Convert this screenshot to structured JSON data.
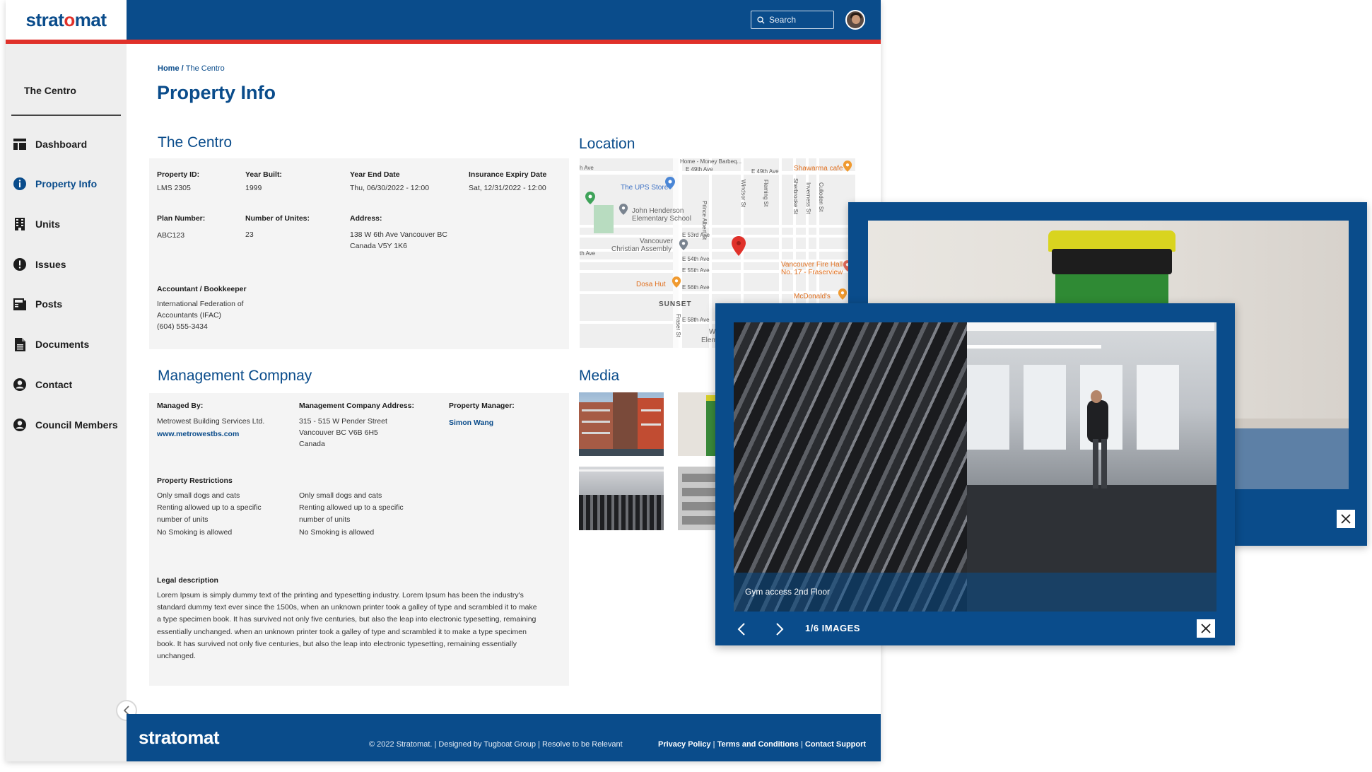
{
  "brand": {
    "name_pre": "strat",
    "name_o": "o",
    "name_post": "mat",
    "footer_name": "stratomat",
    "primary": "#0a4c8b",
    "accent": "#e0312a"
  },
  "header": {
    "search_placeholder": "Search"
  },
  "sidebar": {
    "title": "The Centro",
    "items": [
      {
        "label": "Dashboard",
        "icon": "dashboard-icon"
      },
      {
        "label": "Property Info",
        "icon": "info-icon",
        "active": true
      },
      {
        "label": "Units",
        "icon": "building-icon"
      },
      {
        "label": "Issues",
        "icon": "alert-icon"
      },
      {
        "label": "Posts",
        "icon": "posts-icon"
      },
      {
        "label": "Documents",
        "icon": "document-icon"
      },
      {
        "label": "Contact",
        "icon": "user-icon"
      },
      {
        "label": "Council Members",
        "icon": "user-icon"
      }
    ]
  },
  "breadcrumb": {
    "home": "Home",
    "sep": " / ",
    "current": "The Centro"
  },
  "page_title": "Property Info",
  "property": {
    "section_title": "The Centro",
    "property_id_label": "Property ID:",
    "property_id": "LMS 2305",
    "year_built_label": "Year Built:",
    "year_built": "1999",
    "year_end_label": "Year End Date",
    "year_end": "Thu, 06/30/2022 - 12:00",
    "insurance_label": "Insurance Expiry Date",
    "insurance": "Sat, 12/31/2022 - 12:00",
    "plan_label": "Plan Number:",
    "plan": "ABC123",
    "units_label": "Number of Unites:",
    "units": "23",
    "address_label": "Address:",
    "address": "138 W 6th Ave Vancouver BC\nCanada  V5Y 1K6",
    "accountant_label": "Accountant / Bookkeeper",
    "accountant": "International Federation of\nAccountants (IFAC)\n(604) 555-3434"
  },
  "management": {
    "section_title": "Management Compnay",
    "managed_by_label": "Managed By:",
    "managed_by": "Metrowest Building Services Ltd.",
    "website": "www.metrowestbs.com",
    "address_label": "Management Company Address:",
    "address": "315 - 515 W Pender Street\nVancouver BC V6B 6H5\nCanada",
    "manager_label": "Property Manager:",
    "manager": "Simon Wang",
    "restrictions_label": "Property Restrictions",
    "restrictions_col1": "Only small dogs and cats\nRenting allowed up to a specific\nnumber of units\nNo Smoking is allowed",
    "restrictions_col2": "Only small dogs and cats\nRenting allowed up to a specific\nnumber of units\nNo Smoking is allowed",
    "legal_label": "Legal description",
    "legal": "Lorem Ipsum is simply dummy text of the printing and typesetting industry. Lorem Ipsum has been the industry's standard dummy text ever since the 1500s, when an unknown printer took a galley of type and scrambled it to make a type specimen book. It has survived not only five centuries, but also the leap into electronic typesetting, remaining essentially unchanged. when an unknown printer took a galley of type and scrambled it to make a type specimen book. It has survived not only five centuries, but also the leap into electronic typesetting, remaining essentially unchanged."
  },
  "location": {
    "section_title": "Location",
    "labels": {
      "home_money": "Home - Money Barbeq...",
      "e49_a": "E 49th Ave",
      "e49_b": "E 49th Ave",
      "h_ave": "h Ave",
      "shawarma": "Shawarma cafe",
      "ups": "The UPS Store",
      "jh_1": "John Henderson",
      "jh_2": "Elementary School",
      "e53": "E 53rd Ave",
      "vca_1": "Vancouver",
      "vca_2": "Christian Assembly",
      "th_ave": "th Ave",
      "e54": "E 54th Ave",
      "e55": "E 55th Ave",
      "e56": "E 56th Ave",
      "fire_1": "Vancouver Fire Hall",
      "fire_2": "No. 17 - Fraserview",
      "dosa": "Dosa Hut",
      "mcd": "McDonald's",
      "sunset": "SUNSET",
      "e58": "E 58th Ave",
      "wa": "Wa",
      "eleme": "Eleme",
      "prince_albert": "Prince Albert St",
      "windsor": "Windsor St",
      "fleming": "Fleming St",
      "sherbrooke": "Sherbrooke St",
      "inverness": "Inverness St",
      "culloden": "Culloden St",
      "fraser": "Fraser St"
    }
  },
  "media": {
    "section_title": "Media"
  },
  "lightbox": {
    "caption": "Gym access 2nd Floor",
    "counter": "1/6 IMAGES"
  },
  "footer": {
    "copyright": "© 2022 Stratomat. | Designed by Tugboat Group |  Resolve to be Relevant",
    "privacy": "Privacy Policy",
    "terms": "Terms and Conditions",
    "support": "Contact Support"
  }
}
